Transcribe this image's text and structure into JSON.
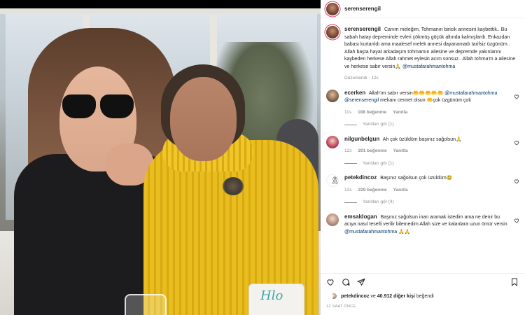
{
  "header": {
    "username": "serenserengil"
  },
  "post": {
    "username": "serenserengil",
    "caption": "Canım meleğim, Tohmanın biricik annesini kaybettik.. Bu sabah hatay depreminde evleri çökmüş göçük altında kalmışlardı. Enkazdan babası kurtarıldı ama maalesef melek annesi dayanamadı tarifsiz üzgünüm.. Allah başta hayat arkadaşım tohmamın ailesine ve depremde yakınlarını kaybeden herkese Allah rahmet eylesin acım sonsuz.. Allah tohma'm a ailesine ve herkese sabır versin🙏",
    "mention": "@mustafarahmantohma",
    "edited": "Düzenlendi",
    "age": "12s"
  },
  "comments": [
    {
      "username": "ecerken",
      "text_before": "Allah'ım sabır versin🤲🤲🤲🤲🤲",
      "mention1": "@mustafarahmantohma",
      "mention2": "@serenserengil",
      "text_after": "mekanı cennet olsun 🤲çok üzgünüm çok",
      "age": "11s",
      "likes": "188 beğenme",
      "reply": "Yanıtla",
      "replies": "Yanıtları gör (1)"
    },
    {
      "username": "nilgunbelgun",
      "text": "Ah çok üzüldüm başınız sağolsun🙏",
      "age": "12s",
      "likes": "201 beğenme",
      "reply": "Yanıtla",
      "replies": "Yanıtları gör (1)"
    },
    {
      "username": "petekdincoz",
      "text": "Başınız sağolsun çok üzüldüm☹️",
      "age": "12s",
      "likes": "229 beğenme",
      "reply": "Yanıtla",
      "replies": "Yanıtları gör (4)"
    },
    {
      "username": "emsaldogan",
      "text": "Başınız sağolsun inan aramak istedim ama ne denir bu acıya nasıl teselli verilir bilemedim Allah size ve kalanlara uzun ömür versin",
      "mention": "@mustafarahmantohma",
      "tail": "🙏🙏"
    }
  ],
  "likes_line": {
    "user": "petekdincoz",
    "connector": "ve",
    "count": "40.912 diğer kişi",
    "suffix": "beğendi"
  },
  "timestamp": "12 SAAT ÖNCE",
  "icons": [
    "heart-icon",
    "comment-icon",
    "share-icon",
    "bookmark-icon"
  ],
  "colors": {
    "link": "#00376b",
    "muted": "#8e8e8e",
    "text": "#262626"
  },
  "photo": {
    "cup_text": "Hlo"
  }
}
